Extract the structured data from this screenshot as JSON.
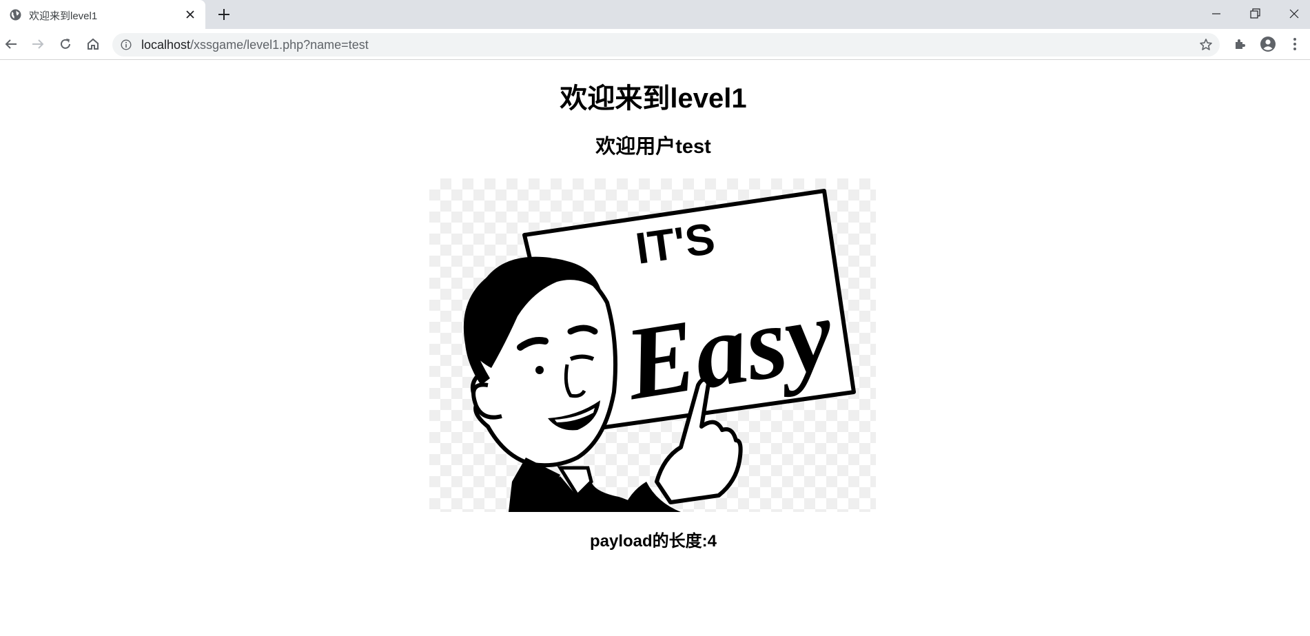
{
  "browser": {
    "tab": {
      "title": "欢迎来到level1",
      "favicon": "globe-icon"
    },
    "new_tab_icon": "plus-icon",
    "window_controls": [
      "minimize-icon",
      "restore-icon",
      "close-icon"
    ],
    "nav": [
      "back-arrow-icon",
      "forward-arrow-icon",
      "reload-icon",
      "home-icon"
    ],
    "address": {
      "host": "localhost",
      "path": "/xssgame/level1.php?name=test",
      "security_icon": "info-icon",
      "bookmark_icon": "star-icon"
    },
    "toolbar_icons": [
      "extensions-puzzle-icon",
      "profile-avatar-icon",
      "kebab-menu-icon"
    ]
  },
  "page": {
    "heading": "欢迎来到level1",
    "welcome_user": "欢迎用户test",
    "image": {
      "sign_text_top": "IT'S",
      "sign_text_main": "Easy"
    },
    "payload_length": "payload的长度:4"
  }
}
